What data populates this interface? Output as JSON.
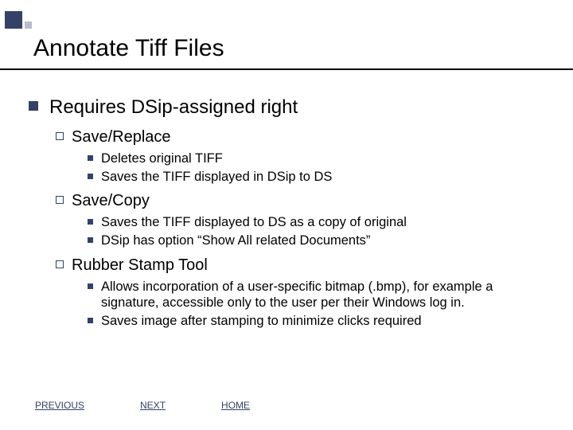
{
  "title": "Annotate Tiff Files",
  "main": {
    "heading": "Requires DSip-assigned right",
    "sections": [
      {
        "label": "Save/Replace",
        "items": [
          "Deletes original TIFF",
          "Saves the TIFF displayed in DSip to DS"
        ]
      },
      {
        "label": "Save/Copy",
        "items": [
          "Saves the TIFF displayed to DS as a copy of original",
          "DSip has option “Show All related Documents”"
        ]
      },
      {
        "label": "Rubber Stamp Tool",
        "items": [
          "Allows incorporation of a user-specific bitmap (.bmp), for example a signature, accessible only to the user per their Windows log in.",
          "Saves image after stamping to minimize clicks required"
        ]
      }
    ]
  },
  "nav": {
    "previous": "PREVIOUS",
    "next": "NEXT",
    "home": "HOME"
  }
}
